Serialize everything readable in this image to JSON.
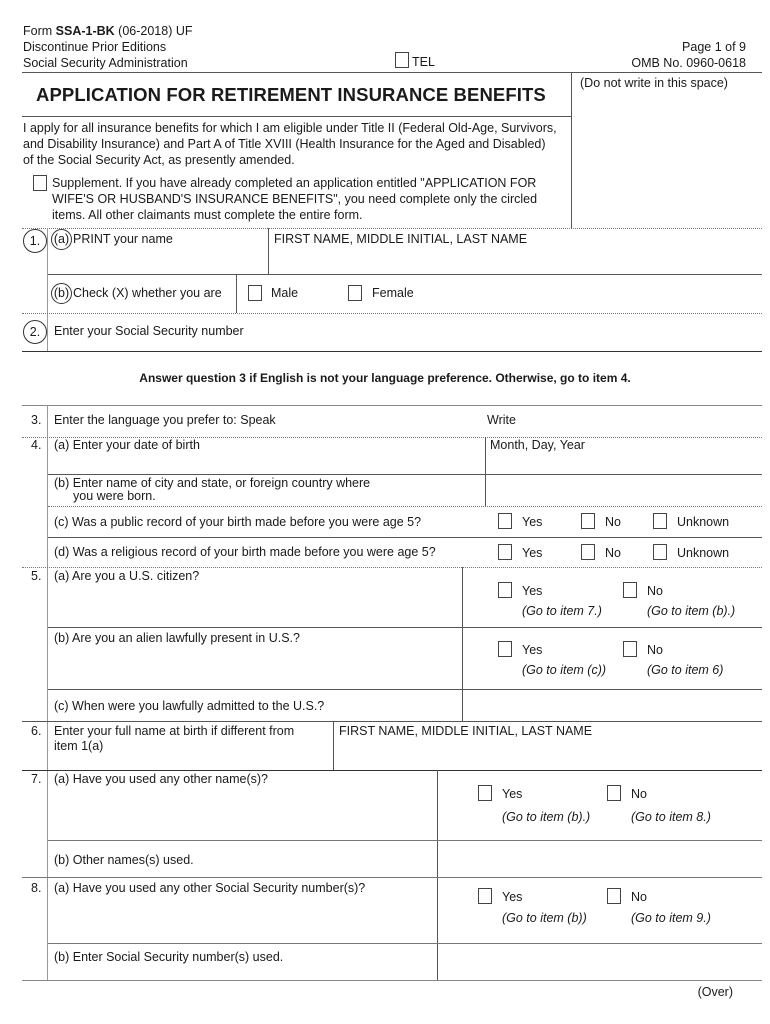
{
  "header": {
    "form_prefix": "Form ",
    "form_id": "SSA-1-BK",
    "form_suffix": " (06-2018) UF",
    "discontinue": "Discontinue Prior Editions",
    "agency": "Social Security Administration",
    "tel_label": "TEL",
    "page": "Page 1 of 9",
    "omb": "OMB No. 0960-0618",
    "office_use": "(Do not write in this space)"
  },
  "title": "APPLICATION FOR RETIREMENT INSURANCE BENEFITS",
  "intro": {
    "line1": "I apply for all insurance benefits for which I am eligible under Title II (Federal Old-Age, Survivors,",
    "line2": "and Disability Insurance) and Part A of Title XVIII (Health Insurance for the Aged and Disabled)",
    "line3": "of the Social Security Act, as presently amended.",
    "supplement_line1": "Supplement. If you have already completed an application entitled \"APPLICATION FOR",
    "supplement_line2": "WIFE'S OR HUSBAND'S INSURANCE BENEFITS\", you need complete only the circled",
    "supplement_line3": "items. All other claimants must complete the entire form."
  },
  "items": {
    "q1": {
      "number": "1.",
      "a_marker": "(a)",
      "a_label": "PRINT your name",
      "a_field_label": "FIRST NAME, MIDDLE INITIAL, LAST NAME",
      "b_marker": "(b)",
      "b_label": "Check (X) whether you are",
      "opt_male": "Male",
      "opt_female": "Female"
    },
    "q2": {
      "number": "2.",
      "label": "Enter your Social Security number"
    },
    "instruction": "Answer question 3 if English is not your language preference. Otherwise, go to item 4.",
    "q3": {
      "number": "3.",
      "label": "Enter the language you prefer to:  Speak",
      "write_label": "Write"
    },
    "q4": {
      "number": "4.",
      "a_label": "(a) Enter your date of birth",
      "a_field_label": "Month, Day, Year",
      "b_label_1": "(b) Enter name of city and state, or foreign country where",
      "b_label_2": "you were born.",
      "c_label": "(c) Was a public record of your birth made before you were age 5?",
      "d_label": "(d) Was a religious record of your birth made before you were age 5?",
      "opt_yes": "Yes",
      "opt_no": "No",
      "opt_unknown": "Unknown"
    },
    "q5": {
      "number": "5.",
      "a_label": "(a) Are you a U.S. citizen?",
      "a_yes": "Yes",
      "a_yes_hint": "(Go to item 7.)",
      "a_no": "No",
      "a_no_hint": "(Go to item (b).)",
      "b_label": "(b) Are you an alien lawfully present in U.S.?",
      "b_yes": "Yes",
      "b_yes_hint": "(Go to item (c))",
      "b_no": "No",
      "b_no_hint": "(Go to item 6)",
      "c_label": "(c) When were you lawfully admitted to the U.S.?"
    },
    "q6": {
      "number": "6.",
      "label_1": "Enter your full name at birth if different from",
      "label_2": "item 1(a)",
      "field_label": "FIRST NAME, MIDDLE INITIAL, LAST NAME"
    },
    "q7": {
      "number": "7.",
      "a_label": "(a) Have you used any other name(s)?",
      "a_yes": "Yes",
      "a_yes_hint": "(Go to item (b).)",
      "a_no": "No",
      "a_no_hint": "(Go to item 8.)",
      "b_label": "(b) Other names(s) used."
    },
    "q8": {
      "number": "8.",
      "a_label": "(a) Have you used any other Social Security number(s)?",
      "a_yes": "Yes",
      "a_yes_hint": "(Go to item (b))",
      "a_no": "No",
      "a_no_hint": "(Go to item 9.)",
      "b_label": "(b) Enter Social Security number(s) used."
    }
  },
  "footer": {
    "over": "(Over)"
  }
}
